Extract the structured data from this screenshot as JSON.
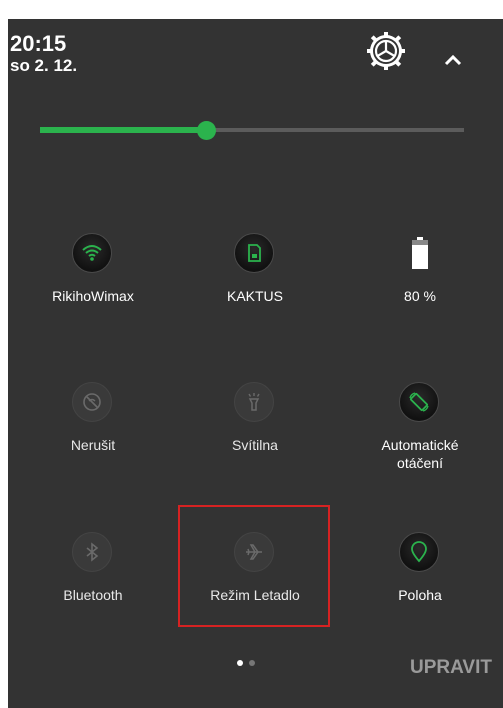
{
  "status": {
    "time": "20:15",
    "date": "so 2. 12."
  },
  "brightness": {
    "level_fraction": 0.41
  },
  "tiles": [
    {
      "label": "RikihoWimax",
      "icon": "wifi-icon",
      "active": true
    },
    {
      "label": "KAKTUS",
      "icon": "sim-card-icon",
      "active": true
    },
    {
      "label": "80 %",
      "icon": "battery-icon",
      "active": true
    },
    {
      "label": "Nerušit",
      "icon": "do-not-disturb-icon",
      "active": false
    },
    {
      "label": "Svítilna",
      "icon": "flashlight-icon",
      "active": false
    },
    {
      "label_line1": "Automatické",
      "label_line2": "otáčení",
      "icon": "auto-rotate-icon",
      "active": true
    },
    {
      "label": "Bluetooth",
      "icon": "bluetooth-icon",
      "active": false
    },
    {
      "label": "Režim Letadlo",
      "icon": "airplane-mode-icon",
      "active": false
    },
    {
      "label": "Poloha",
      "icon": "location-icon",
      "active": true
    }
  ],
  "pager": {
    "pages": 2,
    "current": 1
  },
  "edit_label": "UPRAVIT",
  "colors": {
    "accent": "#2bb34d",
    "panel": "#333333",
    "highlight": "#d62222"
  }
}
